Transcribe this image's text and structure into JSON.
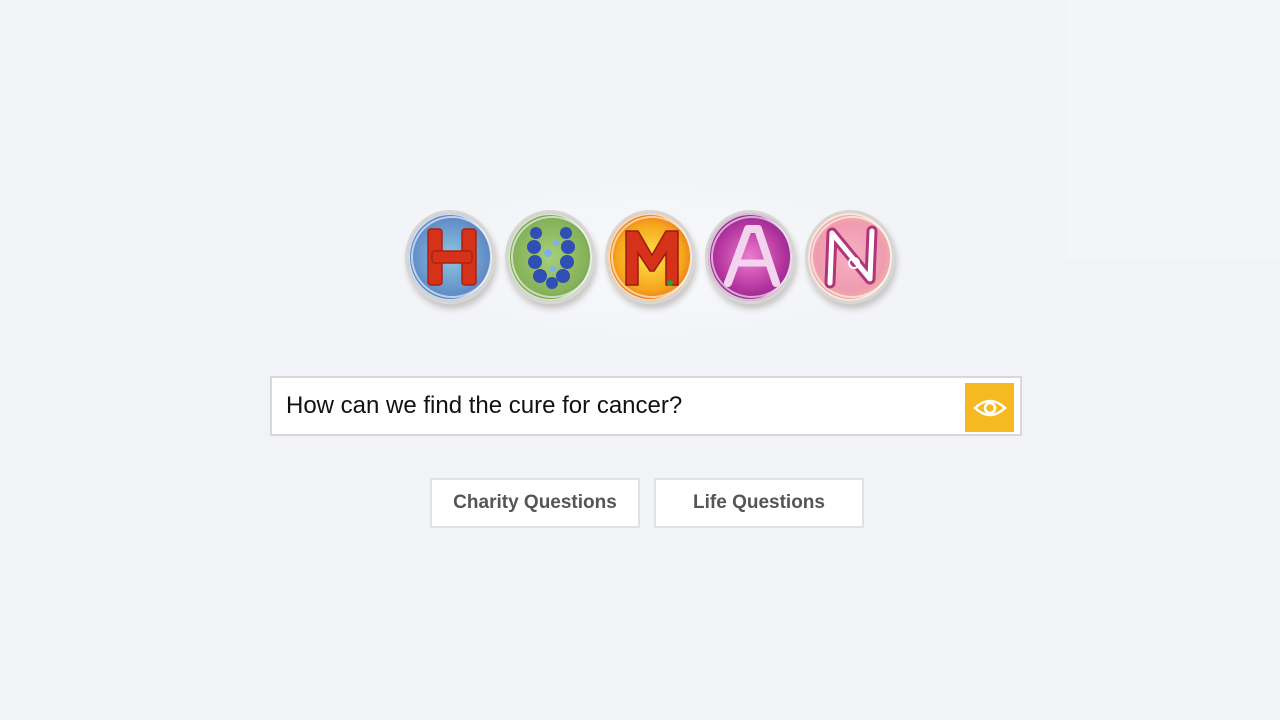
{
  "logo": {
    "letters": [
      "H",
      "U",
      "M",
      "A",
      "N"
    ],
    "colors": {
      "h": "#d6321a",
      "u": "#2f4fb4",
      "m": "#d6321a",
      "a": "#f2d4ee",
      "n": "#ffffff"
    }
  },
  "search": {
    "value": "How can we find the cure for cancer?",
    "button_icon": "eye-icon",
    "button_color": "#f6b921"
  },
  "buttons": {
    "charity_label": "Charity Questions",
    "life_label": "Life Questions"
  }
}
